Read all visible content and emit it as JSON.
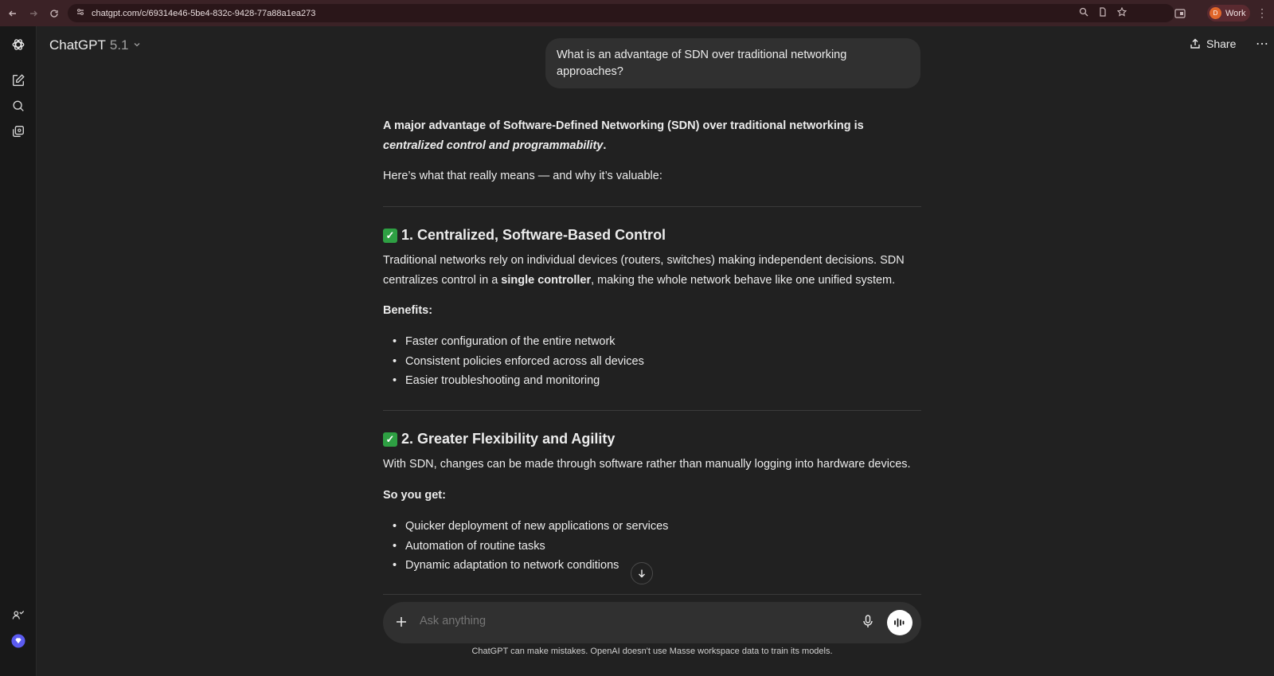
{
  "browser": {
    "url": "chatgpt.com/c/69314e46-5be4-832c-9428-77a88a1ea273",
    "profile_initial": "D",
    "profile_label": "Work"
  },
  "header": {
    "model_name": "ChatGPT",
    "model_version": "5.1",
    "share_label": "Share"
  },
  "conversation": {
    "user_message": "What is an advantage of SDN over traditional networking approaches?",
    "intro_bold": "A major advantage of Software-Defined Networking (SDN) over traditional networking is ",
    "intro_italic": "centralized control and programmability",
    "intro_end": ".",
    "intro_line2": "Here’s what that really means — and why it’s valuable:",
    "section1": {
      "check": "✓",
      "title": "1. Centralized, Software-Based Control",
      "para_a": "Traditional networks rely on individual devices (routers, switches) making independent decisions. SDN centralizes control in a ",
      "para_bold": "single controller",
      "para_b": ", making the whole network behave like one unified system.",
      "benefits_label": "Benefits:",
      "items": [
        "Faster configuration of the entire network",
        "Consistent policies enforced across all devices",
        "Easier troubleshooting and monitoring"
      ]
    },
    "section2": {
      "check": "✓",
      "title": "2. Greater Flexibility and Agility",
      "para": "With SDN, changes can be made through software rather than manually logging into hardware devices.",
      "label": "So you get:",
      "items": [
        "Quicker deployment of new applications or services",
        "Automation of routine tasks",
        "Dynamic adaptation to network conditions"
      ]
    }
  },
  "composer": {
    "placeholder": "Ask anything"
  },
  "footer": {
    "disclaimer": "ChatGPT can make mistakes. OpenAI doesn't use Masse workspace data to train its models."
  },
  "colors": {
    "background": "#212121",
    "sidebar": "#181818",
    "bubble": "#303030",
    "check_green": "#2ea043",
    "browser_bar": "#3b2226",
    "upgrade_badge": "#5b5bf0"
  }
}
